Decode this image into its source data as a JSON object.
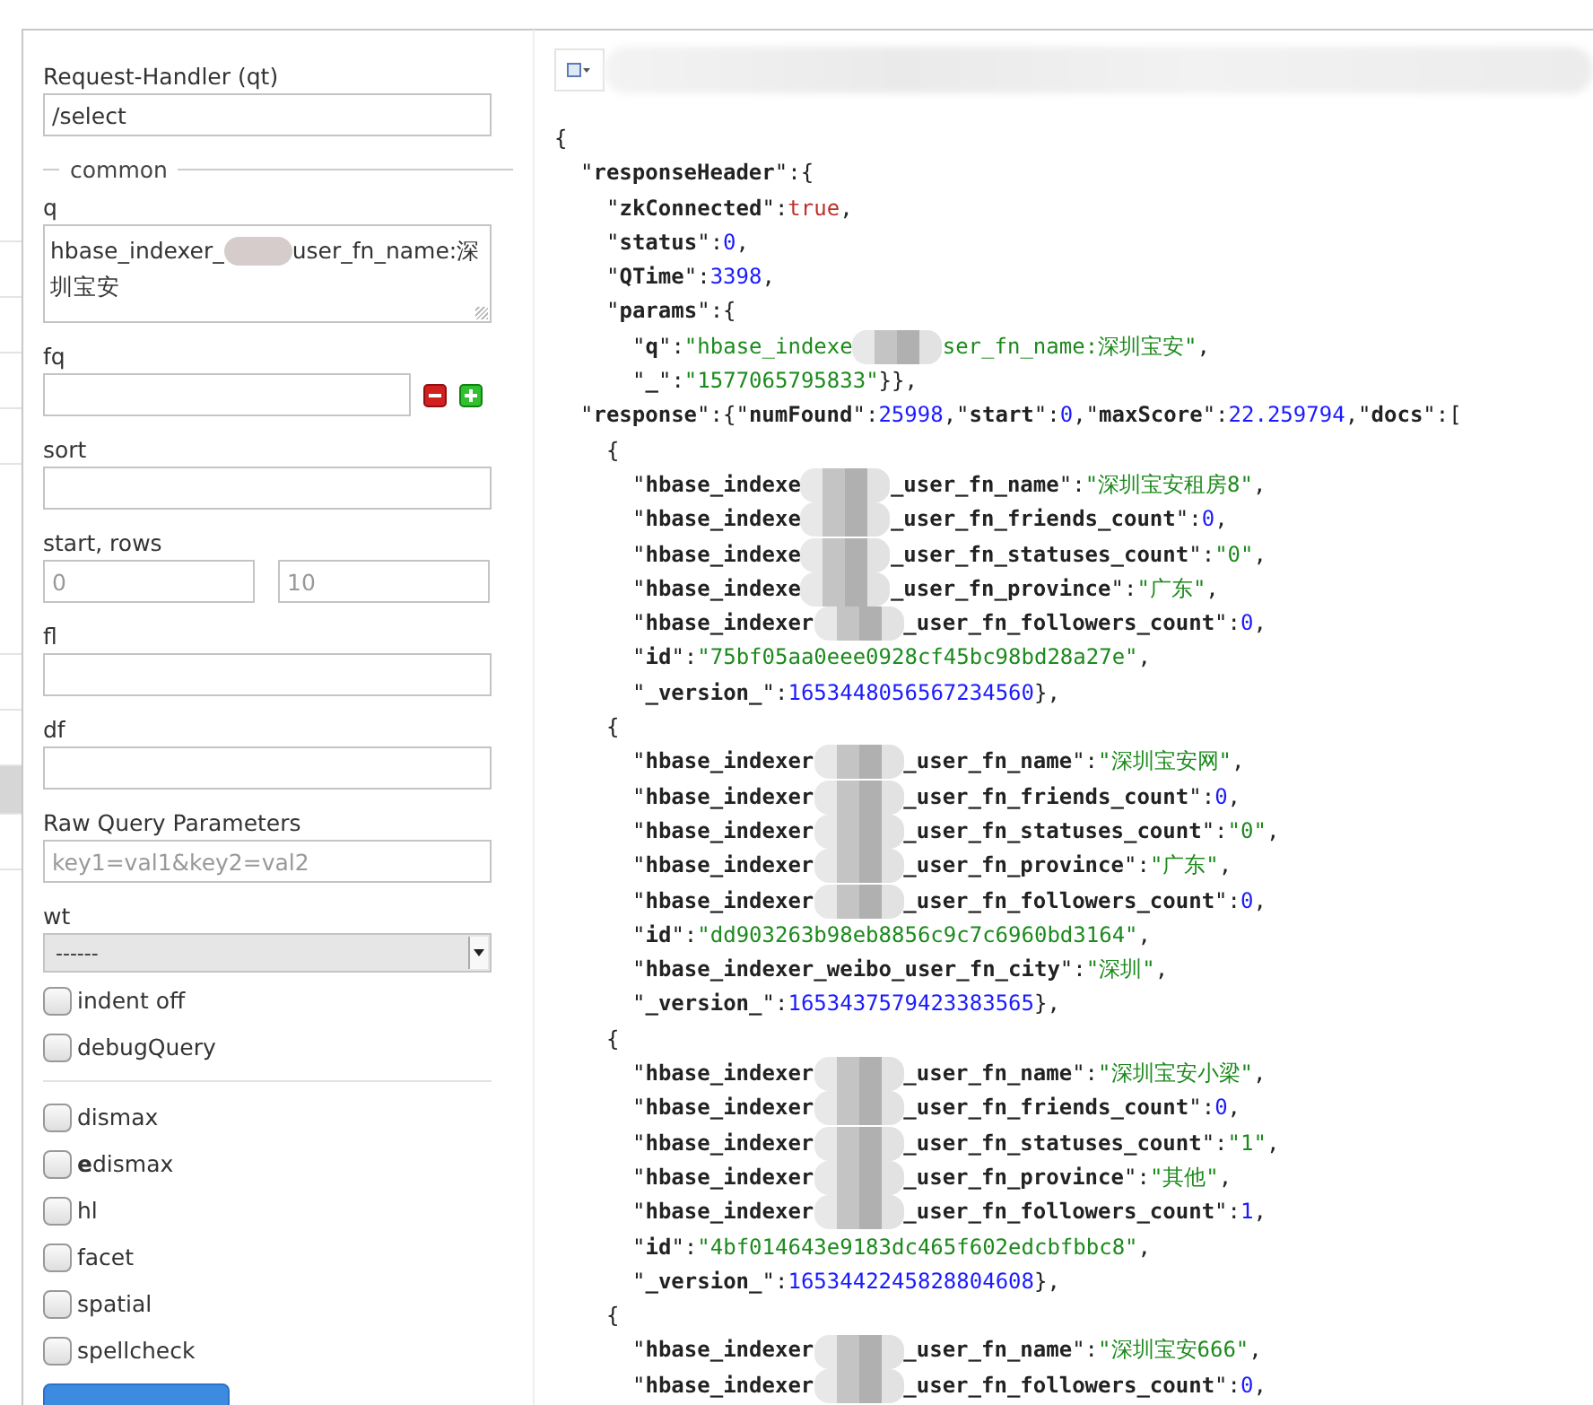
{
  "form": [
    {
      "kind": "text",
      "label": "Request-Handler (qt)",
      "value": "/select"
    },
    {
      "kind": "legend",
      "label": "common"
    },
    {
      "kind": "textarea",
      "label": "q",
      "value_parts": [
        {
          "kind": "text",
          "text": "hbase_indexer_"
        },
        {
          "kind": "redacted"
        },
        {
          "kind": "text",
          "text": "user_fn_name:深"
        },
        {
          "kind": "text",
          "text": "圳宝安"
        }
      ]
    },
    {
      "kind": "filter",
      "label": "fq"
    },
    {
      "kind": "text",
      "label": "sort"
    },
    {
      "kind": "pair",
      "label": "start, rows",
      "placeholders": [
        "0",
        "10"
      ]
    },
    {
      "kind": "text",
      "label": "fl"
    },
    {
      "kind": "text",
      "label": "df"
    },
    {
      "kind": "text",
      "label": "Raw Query Parameters",
      "placeholder": "key1=val1&key2=val2"
    },
    {
      "kind": "select",
      "label": "wt",
      "value": "------"
    },
    {
      "kind": "checkbox",
      "label": "indent off",
      "checked": false
    },
    {
      "kind": "checkbox",
      "label": "debugQuery",
      "checked": false
    },
    {
      "kind": "divider"
    },
    {
      "kind": "checkbox",
      "label": "dismax",
      "checked": false
    },
    {
      "kind": "checkbox",
      "label": "**e**dismax",
      "checked": false
    },
    {
      "kind": "checkbox",
      "label": "hl",
      "checked": false
    },
    {
      "kind": "checkbox",
      "label": "facet",
      "checked": false
    },
    {
      "kind": "checkbox",
      "label": "spatial",
      "checked": false
    },
    {
      "kind": "checkbox",
      "label": "spellcheck",
      "checked": false
    },
    {
      "kind": "button"
    }
  ],
  "response_lines": [
    {
      "tokens": [
        {
          "kind": "plain",
          "text": "{"
        }
      ],
      "children": [
        {
          "tokens": [
            {
              "kind": "plain",
              "text": "\"**responseHeader**\":{"
            }
          ],
          "children": [
            {
              "tokens": [
                {
                  "kind": "plain",
                  "text": "\"**zkConnected**\":"
                },
                {
                  "kind": "bool",
                  "text": "true"
                },
                {
                  "kind": "plain",
                  "text": ","
                }
              ]
            },
            {
              "tokens": [
                {
                  "kind": "plain",
                  "text": "\"**status**\":"
                },
                {
                  "kind": "number",
                  "text": "0"
                },
                {
                  "kind": "plain",
                  "text": ","
                }
              ]
            },
            {
              "tokens": [
                {
                  "kind": "plain",
                  "text": "\"**QTime**\":"
                },
                {
                  "kind": "number",
                  "text": "3398"
                },
                {
                  "kind": "plain",
                  "text": ","
                }
              ]
            },
            {
              "tokens": [
                {
                  "kind": "plain",
                  "text": "\"**params**\":{"
                }
              ],
              "children": [
                {
                  "tokens": [
                    {
                      "kind": "plain",
                      "text": "\"**q**\":"
                    },
                    {
                      "kind": "string",
                      "text": "\"hbase_indexe"
                    },
                    {
                      "kind": "redacted"
                    },
                    {
                      "kind": "string",
                      "text": "ser_fn_name:深圳宝安\""
                    },
                    {
                      "kind": "plain",
                      "text": ","
                    }
                  ]
                },
                {
                  "tokens": [
                    {
                      "kind": "plain",
                      "text": "\"**_**\":"
                    },
                    {
                      "kind": "string",
                      "text": "\"1577065795833\""
                    },
                    {
                      "kind": "plain",
                      "text": "}},"
                    }
                  ]
                }
              ]
            }
          ]
        },
        {
          "tokens": [
            {
              "kind": "plain",
              "text": "\"**response**\":{\"**numFound**\":"
            },
            {
              "kind": "number",
              "text": "25998"
            },
            {
              "kind": "plain",
              "text": ",\"**start**\":"
            },
            {
              "kind": "number",
              "text": "0"
            },
            {
              "kind": "plain",
              "text": ",\"**maxScore**\":"
            },
            {
              "kind": "number",
              "text": "22.259794"
            },
            {
              "kind": "plain",
              "text": ",\"**docs**\":["
            }
          ],
          "children": [
            {
              "tokens": [
                {
                  "kind": "plain",
                  "text": "{"
                }
              ],
              "children": [
                {
                  "tokens": [
                    {
                      "kind": "plain",
                      "text": "\"**hbase_indexe**"
                    },
                    {
                      "kind": "redacted"
                    },
                    {
                      "kind": "plain",
                      "text": "**_user_fn_name**\":"
                    },
                    {
                      "kind": "string",
                      "text": "\"深圳宝安租房8\""
                    },
                    {
                      "kind": "plain",
                      "text": ","
                    }
                  ]
                },
                {
                  "tokens": [
                    {
                      "kind": "plain",
                      "text": "\"**hbase_indexe**"
                    },
                    {
                      "kind": "redacted"
                    },
                    {
                      "kind": "plain",
                      "text": "**_user_fn_friends_count**\":"
                    },
                    {
                      "kind": "number",
                      "text": "0"
                    },
                    {
                      "kind": "plain",
                      "text": ","
                    }
                  ]
                },
                {
                  "tokens": [
                    {
                      "kind": "plain",
                      "text": "\"**hbase_indexe**"
                    },
                    {
                      "kind": "redacted"
                    },
                    {
                      "kind": "plain",
                      "text": "**_user_fn_statuses_count**\":"
                    },
                    {
                      "kind": "string",
                      "text": "\"0\""
                    },
                    {
                      "kind": "plain",
                      "text": ","
                    }
                  ]
                },
                {
                  "tokens": [
                    {
                      "kind": "plain",
                      "text": "\"**hbase_indexe**"
                    },
                    {
                      "kind": "redacted"
                    },
                    {
                      "kind": "plain",
                      "text": "**_user_fn_province**\":"
                    },
                    {
                      "kind": "string",
                      "text": "\"广东\""
                    },
                    {
                      "kind": "plain",
                      "text": ","
                    }
                  ]
                },
                {
                  "tokens": [
                    {
                      "kind": "plain",
                      "text": "\"**hbase_indexer**"
                    },
                    {
                      "kind": "redacted"
                    },
                    {
                      "kind": "plain",
                      "text": "**_user_fn_followers_count**\":"
                    },
                    {
                      "kind": "number",
                      "text": "0"
                    },
                    {
                      "kind": "plain",
                      "text": ","
                    }
                  ]
                },
                {
                  "tokens": [
                    {
                      "kind": "plain",
                      "text": "\"**id**\":"
                    },
                    {
                      "kind": "string",
                      "text": "\"75bf05aa0eee0928cf45bc98bd28a27e\""
                    },
                    {
                      "kind": "plain",
                      "text": ","
                    }
                  ]
                },
                {
                  "tokens": [
                    {
                      "kind": "plain",
                      "text": "\"**_version_**\":"
                    },
                    {
                      "kind": "number",
                      "text": "1653448056567234560"
                    },
                    {
                      "kind": "plain",
                      "text": "},"
                    }
                  ]
                }
              ]
            },
            {
              "tokens": [
                {
                  "kind": "plain",
                  "text": "{"
                }
              ],
              "children": [
                {
                  "tokens": [
                    {
                      "kind": "plain",
                      "text": "\"**hbase_indexer**"
                    },
                    {
                      "kind": "redacted"
                    },
                    {
                      "kind": "plain",
                      "text": "**_user_fn_name**\":"
                    },
                    {
                      "kind": "string",
                      "text": "\"深圳宝安网\""
                    },
                    {
                      "kind": "plain",
                      "text": ","
                    }
                  ]
                },
                {
                  "tokens": [
                    {
                      "kind": "plain",
                      "text": "\"**hbase_indexer**"
                    },
                    {
                      "kind": "redacted"
                    },
                    {
                      "kind": "plain",
                      "text": "**_user_fn_friends_count**\":"
                    },
                    {
                      "kind": "number",
                      "text": "0"
                    },
                    {
                      "kind": "plain",
                      "text": ","
                    }
                  ]
                },
                {
                  "tokens": [
                    {
                      "kind": "plain",
                      "text": "\"**hbase_indexer**"
                    },
                    {
                      "kind": "redacted"
                    },
                    {
                      "kind": "plain",
                      "text": "**_user_fn_statuses_count**\":"
                    },
                    {
                      "kind": "string",
                      "text": "\"0\""
                    },
                    {
                      "kind": "plain",
                      "text": ","
                    }
                  ]
                },
                {
                  "tokens": [
                    {
                      "kind": "plain",
                      "text": "\"**hbase_indexer**"
                    },
                    {
                      "kind": "redacted"
                    },
                    {
                      "kind": "plain",
                      "text": "**_user_fn_province**\":"
                    },
                    {
                      "kind": "string",
                      "text": "\"广东\""
                    },
                    {
                      "kind": "plain",
                      "text": ","
                    }
                  ]
                },
                {
                  "tokens": [
                    {
                      "kind": "plain",
                      "text": "\"**hbase_indexer**"
                    },
                    {
                      "kind": "redacted"
                    },
                    {
                      "kind": "plain",
                      "text": "**_user_fn_followers_count**\":"
                    },
                    {
                      "kind": "number",
                      "text": "0"
                    },
                    {
                      "kind": "plain",
                      "text": ","
                    }
                  ]
                },
                {
                  "tokens": [
                    {
                      "kind": "plain",
                      "text": "\"**id**\":"
                    },
                    {
                      "kind": "string",
                      "text": "\"dd903263b98eb8856c9c7c6960bd3164\""
                    },
                    {
                      "kind": "plain",
                      "text": ","
                    }
                  ]
                },
                {
                  "tokens": [
                    {
                      "kind": "plain",
                      "text": "\"**hbase_indexer_weibo_user_fn_city**\":"
                    },
                    {
                      "kind": "string",
                      "text": "\"深圳\""
                    },
                    {
                      "kind": "plain",
                      "text": ","
                    }
                  ]
                },
                {
                  "tokens": [
                    {
                      "kind": "plain",
                      "text": "\"**_version_**\":"
                    },
                    {
                      "kind": "number",
                      "text": "1653437579423383565"
                    },
                    {
                      "kind": "plain",
                      "text": "},"
                    }
                  ]
                }
              ]
            },
            {
              "tokens": [
                {
                  "kind": "plain",
                  "text": "{"
                }
              ],
              "children": [
                {
                  "tokens": [
                    {
                      "kind": "plain",
                      "text": "\"**hbase_indexer**"
                    },
                    {
                      "kind": "redacted"
                    },
                    {
                      "kind": "plain",
                      "text": "**_user_fn_name**\":"
                    },
                    {
                      "kind": "string",
                      "text": "\"深圳宝安小梁\""
                    },
                    {
                      "kind": "plain",
                      "text": ","
                    }
                  ]
                },
                {
                  "tokens": [
                    {
                      "kind": "plain",
                      "text": "\"**hbase_indexer**"
                    },
                    {
                      "kind": "redacted"
                    },
                    {
                      "kind": "plain",
                      "text": "**_user_fn_friends_count**\":"
                    },
                    {
                      "kind": "number",
                      "text": "0"
                    },
                    {
                      "kind": "plain",
                      "text": ","
                    }
                  ]
                },
                {
                  "tokens": [
                    {
                      "kind": "plain",
                      "text": "\"**hbase_indexer**"
                    },
                    {
                      "kind": "redacted"
                    },
                    {
                      "kind": "plain",
                      "text": "**_user_fn_statuses_count**\":"
                    },
                    {
                      "kind": "string",
                      "text": "\"1\""
                    },
                    {
                      "kind": "plain",
                      "text": ","
                    }
                  ]
                },
                {
                  "tokens": [
                    {
                      "kind": "plain",
                      "text": "\"**hbase_indexer**"
                    },
                    {
                      "kind": "redacted"
                    },
                    {
                      "kind": "plain",
                      "text": "**_user_fn_province**\":"
                    },
                    {
                      "kind": "string",
                      "text": "\"其他\""
                    },
                    {
                      "kind": "plain",
                      "text": ","
                    }
                  ]
                },
                {
                  "tokens": [
                    {
                      "kind": "plain",
                      "text": "\"**hbase_indexer**"
                    },
                    {
                      "kind": "redacted"
                    },
                    {
                      "kind": "plain",
                      "text": "**_user_fn_followers_count**\":"
                    },
                    {
                      "kind": "number",
                      "text": "1"
                    },
                    {
                      "kind": "plain",
                      "text": ","
                    }
                  ]
                },
                {
                  "tokens": [
                    {
                      "kind": "plain",
                      "text": "\"**id**\":"
                    },
                    {
                      "kind": "string",
                      "text": "\"4bf014643e9183dc465f602edcbfbbc8\""
                    },
                    {
                      "kind": "plain",
                      "text": ","
                    }
                  ]
                },
                {
                  "tokens": [
                    {
                      "kind": "plain",
                      "text": "\"**_version_**\":"
                    },
                    {
                      "kind": "number",
                      "text": "1653442245828804608"
                    },
                    {
                      "kind": "plain",
                      "text": "},"
                    }
                  ]
                }
              ]
            },
            {
              "tokens": [
                {
                  "kind": "plain",
                  "text": "{"
                }
              ],
              "children": [
                {
                  "tokens": [
                    {
                      "kind": "plain",
                      "text": "\"**hbase_indexer**"
                    },
                    {
                      "kind": "redacted"
                    },
                    {
                      "kind": "plain",
                      "text": "**_user_fn_name**\":"
                    },
                    {
                      "kind": "string",
                      "text": "\"深圳宝安666\""
                    },
                    {
                      "kind": "plain",
                      "text": ","
                    }
                  ]
                },
                {
                  "tokens": [
                    {
                      "kind": "plain",
                      "text": "\"**hbase_indexer**"
                    },
                    {
                      "kind": "redacted"
                    },
                    {
                      "kind": "plain",
                      "text": "**_user_fn_followers_count**\":"
                    },
                    {
                      "kind": "number",
                      "text": "0"
                    },
                    {
                      "kind": "plain",
                      "text": ","
                    }
                  ]
                }
              ]
            }
          ]
        }
      ]
    }
  ]
}
